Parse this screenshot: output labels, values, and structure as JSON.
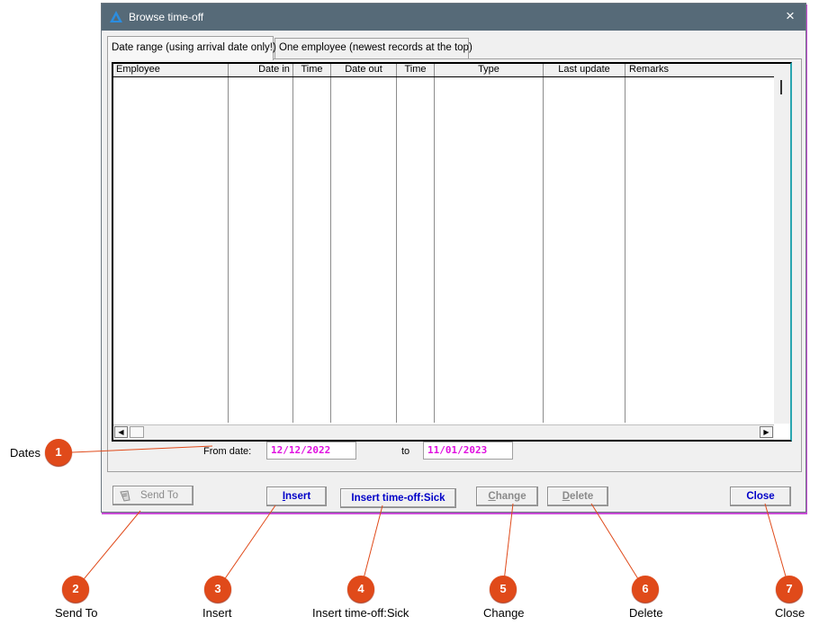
{
  "window": {
    "title": "Browse time-off",
    "close_glyph": "×"
  },
  "tabs": [
    {
      "label": "Date range (using arrival date only!)",
      "active": true
    },
    {
      "label": "One employee (newest records at the top)",
      "active": false
    }
  ],
  "table": {
    "columns": [
      "Employee",
      "Date in",
      "Time",
      "Date out",
      "Time",
      "Type",
      "Last update",
      "Remarks"
    ],
    "rows": []
  },
  "scroll": {
    "left_glyph": "◀",
    "right_glyph": "▶"
  },
  "dates": {
    "from_label": "From date:",
    "from_value": "12/12/2022",
    "to_label": "to",
    "to_value": "11/01/2023",
    "value_color": "#e010e0"
  },
  "buttons": {
    "send_to": "Send To",
    "insert_prefix": "I",
    "insert_rest": "nsert",
    "insert_sick": "Insert time-off:Sick",
    "change_prefix": "C",
    "change_rest": "hange",
    "delete_prefix": "D",
    "delete_rest": "elete",
    "close": "Close"
  },
  "callouts": [
    {
      "num": "1",
      "label": "Dates"
    },
    {
      "num": "2",
      "label": "Send To"
    },
    {
      "num": "3",
      "label": "Insert"
    },
    {
      "num": "4",
      "label": "Insert time-off:Sick"
    },
    {
      "num": "5",
      "label": "Change"
    },
    {
      "num": "6",
      "label": "Delete"
    },
    {
      "num": "7",
      "label": "Close"
    }
  ],
  "colors": {
    "titlebar": "#566a78",
    "callout": "#e04a1a",
    "button_text": "#0000c8",
    "accent_border": "#2aa6b0"
  },
  "icons": [
    "app-logo-icon",
    "close-icon",
    "scroll-left-icon",
    "scroll-right-icon",
    "send-to-icon"
  ]
}
